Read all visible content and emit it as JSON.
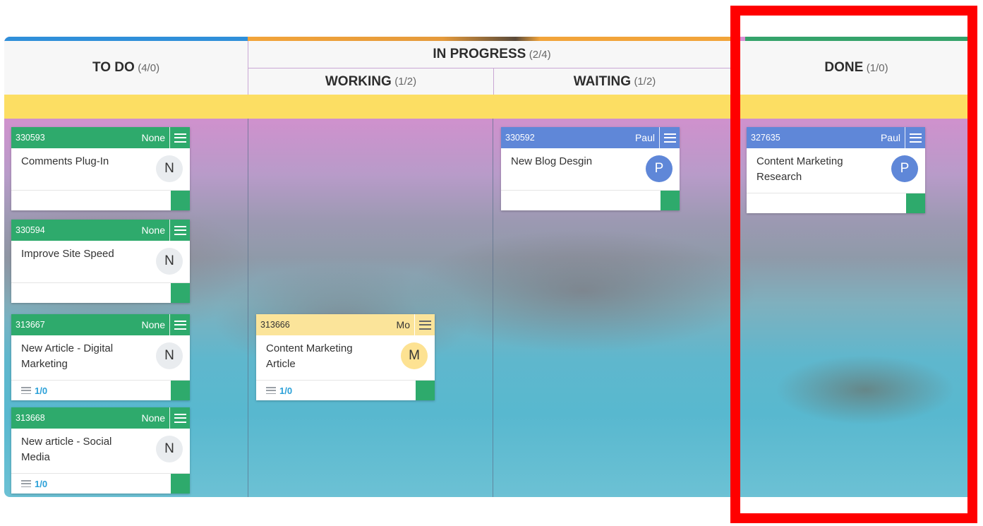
{
  "columns": {
    "todo": {
      "label": "TO DO",
      "count": "(4/0)"
    },
    "in_progress": {
      "label": "IN PROGRESS",
      "count": "(2/4)"
    },
    "working": {
      "label": "WORKING",
      "count": "(1/2)"
    },
    "waiting": {
      "label": "WAITING",
      "count": "(1/2)"
    },
    "done": {
      "label": "DONE",
      "count": "(1/0)"
    }
  },
  "cards": [
    {
      "id": "330593",
      "owner": "None",
      "title": "Comments Plug-In",
      "initial": "N",
      "subtasks": ""
    },
    {
      "id": "330594",
      "owner": "None",
      "title": "Improve Site Speed",
      "initial": "N",
      "subtasks": ""
    },
    {
      "id": "313667",
      "owner": "None",
      "title": "New Article - Digital Marketing",
      "initial": "N",
      "subtasks": "1/0"
    },
    {
      "id": "313668",
      "owner": "None",
      "title": "New article - Social Media",
      "initial": "N",
      "subtasks": "1/0"
    },
    {
      "id": "313666",
      "owner": "Mo",
      "title": "Content Marketing Article",
      "initial": "M",
      "subtasks": "1/0"
    },
    {
      "id": "330592",
      "owner": "Paul",
      "title": "New Blog Desgin",
      "initial": "P",
      "subtasks": ""
    },
    {
      "id": "327635",
      "owner": "Paul",
      "title": "Content Marketing Research",
      "initial": "P",
      "subtasks": ""
    }
  ],
  "colors": {
    "todo_accent": "#2f8fd9",
    "in_progress_accent": "#f2a43a",
    "done_accent": "#35a36b",
    "swimlane": "#fcde63",
    "card_green": "#2eaa6c",
    "card_blue": "#5f87d8",
    "card_yellow": "#fbe49a",
    "highlight": "#ff0000"
  }
}
